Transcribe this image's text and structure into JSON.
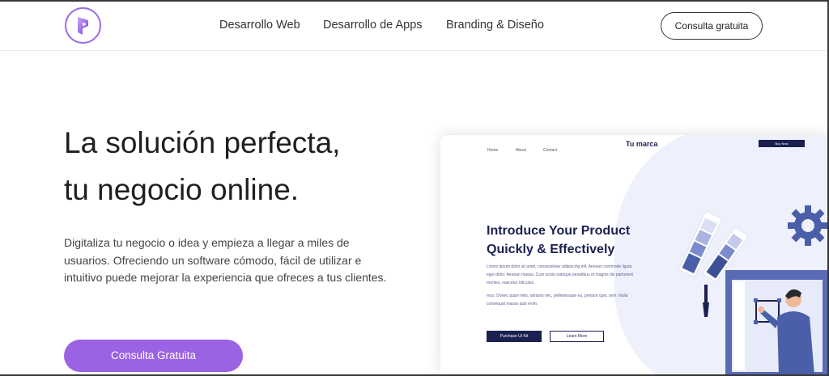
{
  "header": {
    "nav": [
      "Desarrollo Web",
      "Desarrollo de Apps",
      "Branding & Diseño"
    ],
    "cta_label": "Consulta gratuita"
  },
  "hero": {
    "title_line1": "La solución perfecta,",
    "title_line2": "tu negocio online.",
    "description": "Digitaliza tu negocio o idea y empieza a llegar a miles de usuarios. Ofreciendo un software cómodo, fácil de utilizar e intuitivo puede mejorar la experiencia que ofreces a tus clientes.",
    "cta_label": "Consulta Gratuita"
  },
  "mockup": {
    "nav": [
      "Home",
      "About",
      "Contact"
    ],
    "brand": "Tu marca",
    "buy_label": "Buy Now",
    "title_line1": "Introduce Your Product",
    "title_line2": "Quickly & Effectively",
    "paragraph1": "Lorem ipsum dolor sit amet, consectetuer adipiscing elit. Aenean commodo ligula eget dolor. Aenean massa. Cum sociis natoque penatibus et magnis dis parturient montes, nascetur ridiculus",
    "paragraph2": "mus. Donec quam felis, ultricies nec, pellentesque eu, pretium quis, sem. Nulla consequat massa quis enim.",
    "button_primary": "Purchase UI Kit",
    "button_secondary": "Learn More"
  },
  "colors": {
    "brand_purple": "#9b63e3",
    "navy": "#1b2050",
    "mockup_bg": "#eef0fb"
  },
  "icons": [
    "logo-icon",
    "gear-icon",
    "paint-swatch-icon"
  ]
}
